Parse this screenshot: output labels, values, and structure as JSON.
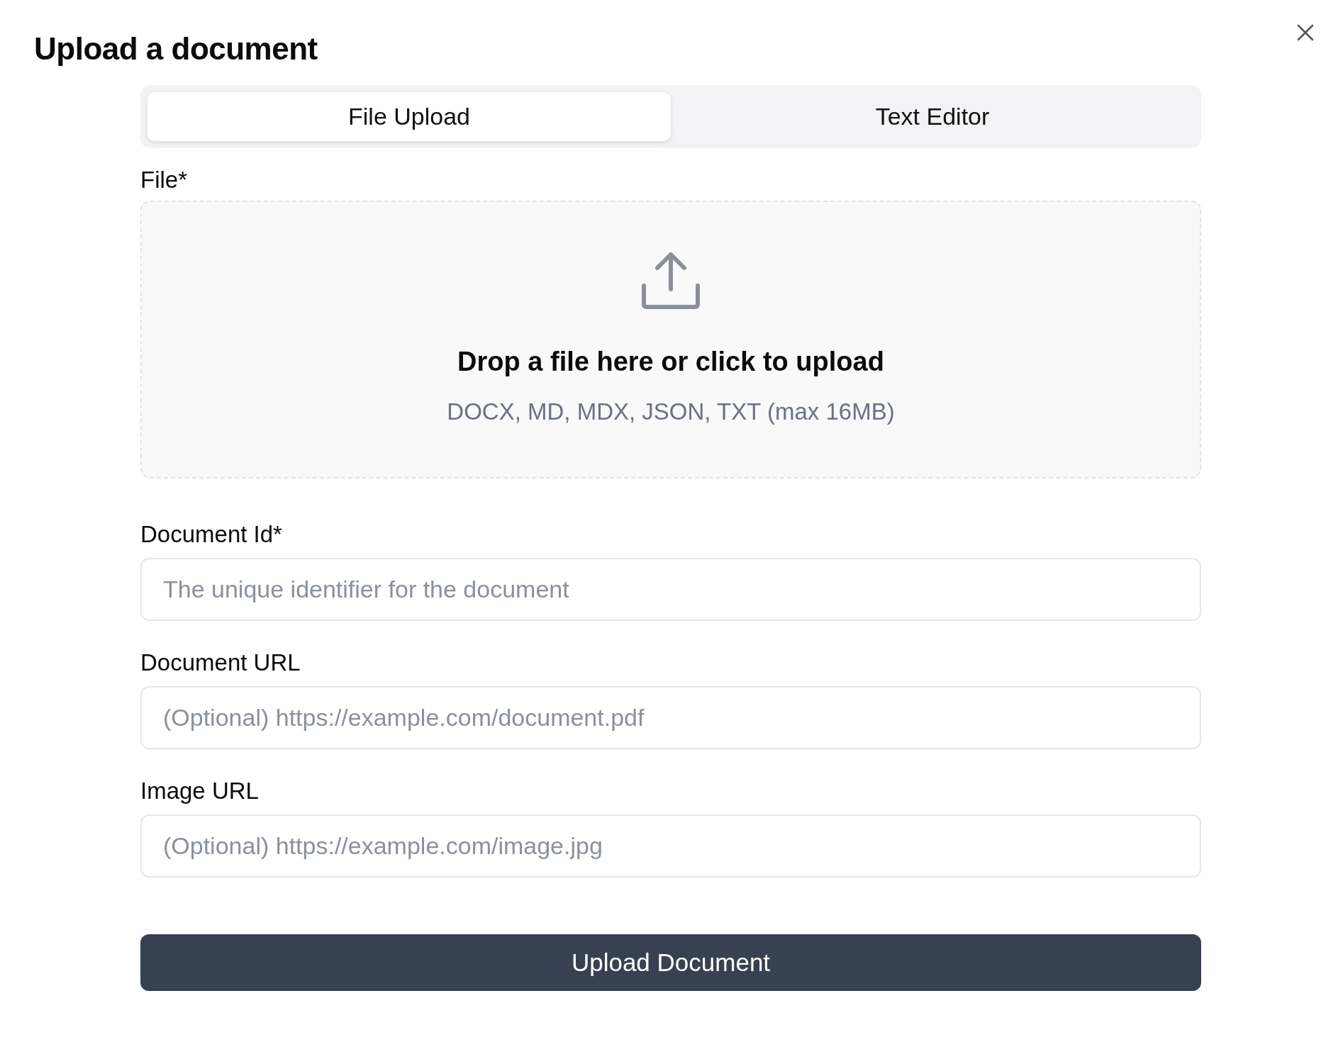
{
  "dialog": {
    "title": "Upload a document"
  },
  "tabs": [
    {
      "label": "File Upload",
      "selected": true
    },
    {
      "label": "Text Editor",
      "selected": false
    }
  ],
  "file_field": {
    "label": "File*",
    "drop_text": "Drop a file here or click to upload",
    "formats": "DOCX, MD, MDX, JSON, TXT (max 16MB)"
  },
  "fields": [
    {
      "label": "Document Id*",
      "placeholder": "The unique identifier for the document"
    },
    {
      "label": "Document URL",
      "placeholder": "(Optional) https://example.com/document.pdf"
    },
    {
      "label": "Image URL",
      "placeholder": "(Optional) https://example.com/image.jpg"
    }
  ],
  "submit_button": "Upload Document"
}
